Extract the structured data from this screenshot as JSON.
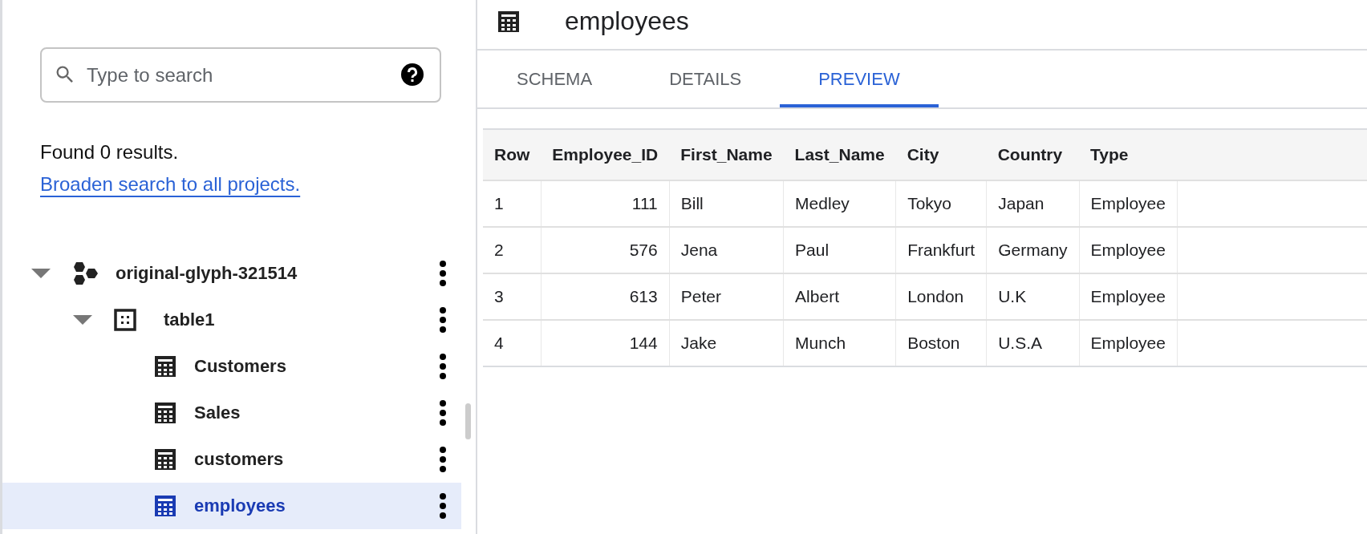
{
  "sidebar": {
    "search": {
      "placeholder": "Type to search"
    },
    "result_text": "Found 0 results.",
    "result_link": "Broaden search to all projects.",
    "tree": [
      {
        "kind": "project",
        "label": "original-glyph-321514",
        "expanded": true,
        "selected": false,
        "children": [
          {
            "kind": "dataset",
            "label": "table1",
            "expanded": true,
            "selected": false,
            "children": [
              {
                "kind": "table",
                "label": "Customers",
                "selected": false
              },
              {
                "kind": "table",
                "label": "Sales",
                "selected": false
              },
              {
                "kind": "table",
                "label": "customers",
                "selected": false
              },
              {
                "kind": "table",
                "label": "employees",
                "selected": true
              }
            ]
          }
        ]
      }
    ]
  },
  "main": {
    "title": "employees",
    "tabs": [
      {
        "label": "SCHEMA",
        "selected": false
      },
      {
        "label": "DETAILS",
        "selected": false
      },
      {
        "label": "PREVIEW",
        "selected": true
      }
    ],
    "table": {
      "columns": [
        "Row",
        "Employee_ID",
        "First_Name",
        "Last_Name",
        "City",
        "Country",
        "Type"
      ],
      "rows": [
        [
          "1",
          "111",
          "Bill",
          "Medley",
          "Tokyo",
          "Japan",
          "Employee"
        ],
        [
          "2",
          "576",
          "Jena",
          "Paul",
          "Frankfurt",
          "Germany",
          "Employee"
        ],
        [
          "3",
          "613",
          "Peter",
          "Albert",
          "London",
          "U.K",
          "Employee"
        ],
        [
          "4",
          "144",
          "Jake",
          "Munch",
          "Boston",
          "U.S.A",
          "Employee"
        ]
      ]
    }
  }
}
